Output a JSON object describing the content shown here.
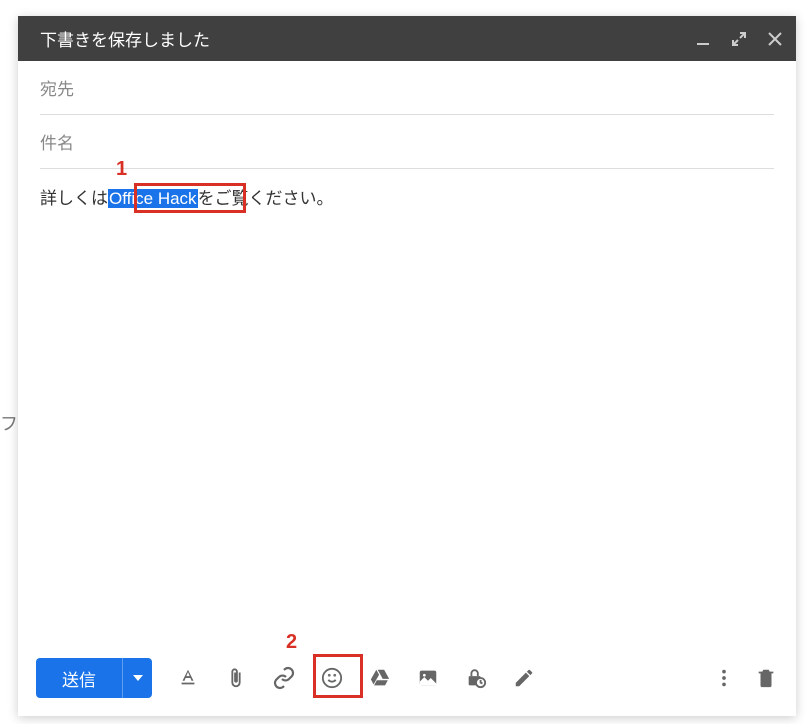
{
  "background": {
    "letter": "フ"
  },
  "header": {
    "title": "下書きを保存しました"
  },
  "fields": {
    "to_label": "宛先",
    "subject_label": "件名"
  },
  "body": {
    "prefix": "詳しくは",
    "selected": "Office Hack",
    "suffix": "をご覧ください。"
  },
  "toolbar": {
    "send_label": "送信"
  },
  "annotations": {
    "label1": "1",
    "label2": "2"
  }
}
